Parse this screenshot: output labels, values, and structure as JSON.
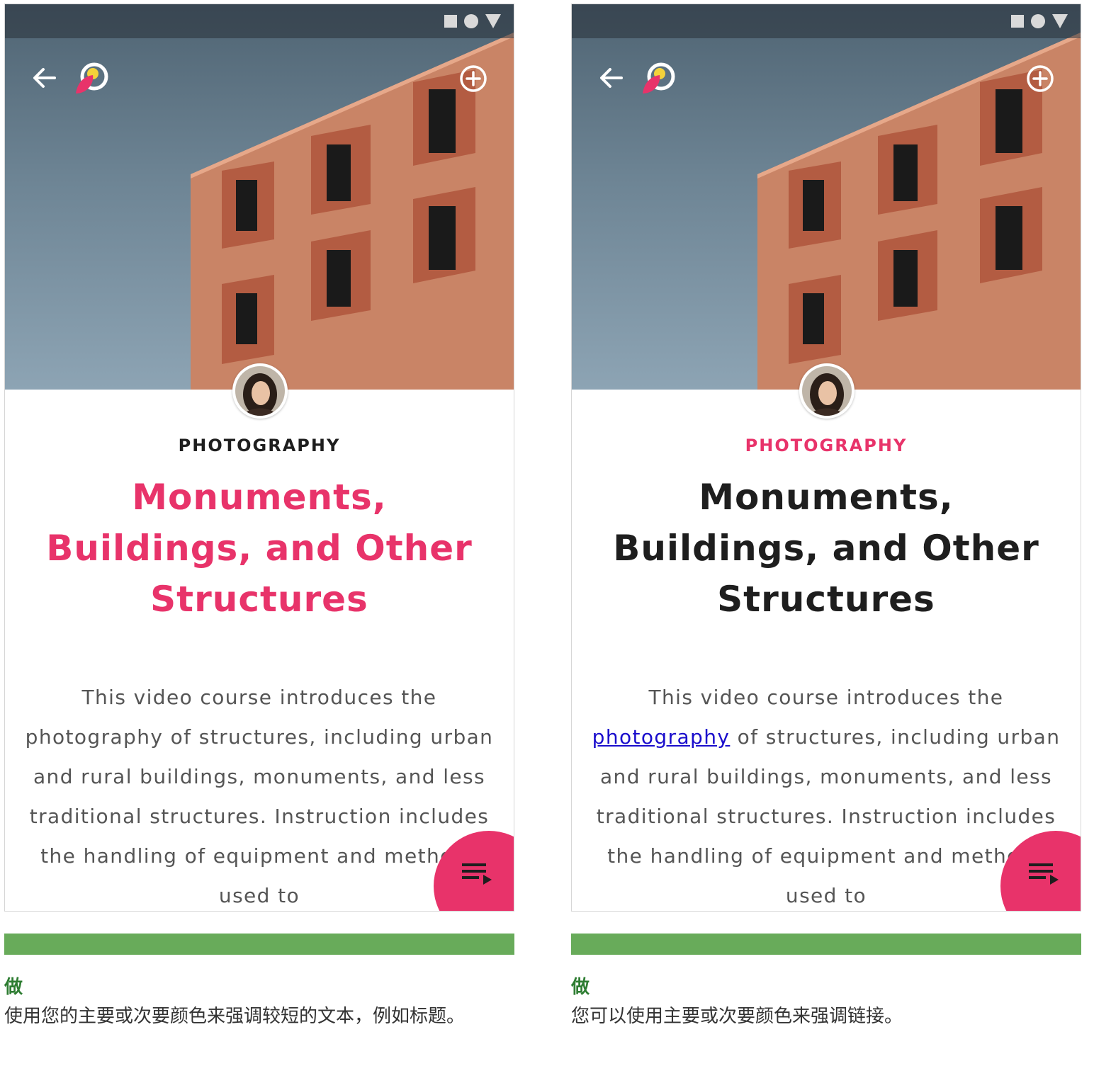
{
  "colors": {
    "accent_pink": "#e8336a",
    "dark_text": "#1e1e1e",
    "body_text": "#555555",
    "link_blue": "#1a0dcc",
    "do_green": "#68ab5a",
    "verdict_green": "#2e7d32"
  },
  "icons": {
    "back": "arrow-back-icon",
    "logo": "app-logo-icon",
    "add": "add-circle-icon",
    "fab": "playlist-play-icon",
    "status": [
      "square-icon",
      "circle-icon",
      "triangle-icon"
    ]
  },
  "examples": [
    {
      "category": "PHOTOGRAPHY",
      "title": "Monuments, Buildings, and Other Structures",
      "body_before_link": "This video course introduces the photography of structures, including urban and rural buildings, monuments, and less traditional structures. Instruction includes the handling of equipment and methods used to",
      "verdict": "做",
      "caption": "使用您的主要或次要颜色来强调较短的文本，例如标题。"
    },
    {
      "category": "PHOTOGRAPHY",
      "title": "Monuments, Buildings, and Other Structures",
      "body_before_link": "This video course introduces the",
      "link_text": "photography",
      "body_after_link": "of structures, including urban and rural buildings, monuments, and less traditional structures. Instruction includes the handling of equipment and methods used to",
      "verdict": "做",
      "caption": "您可以使用主要或次要颜色来强调链接。"
    }
  ]
}
